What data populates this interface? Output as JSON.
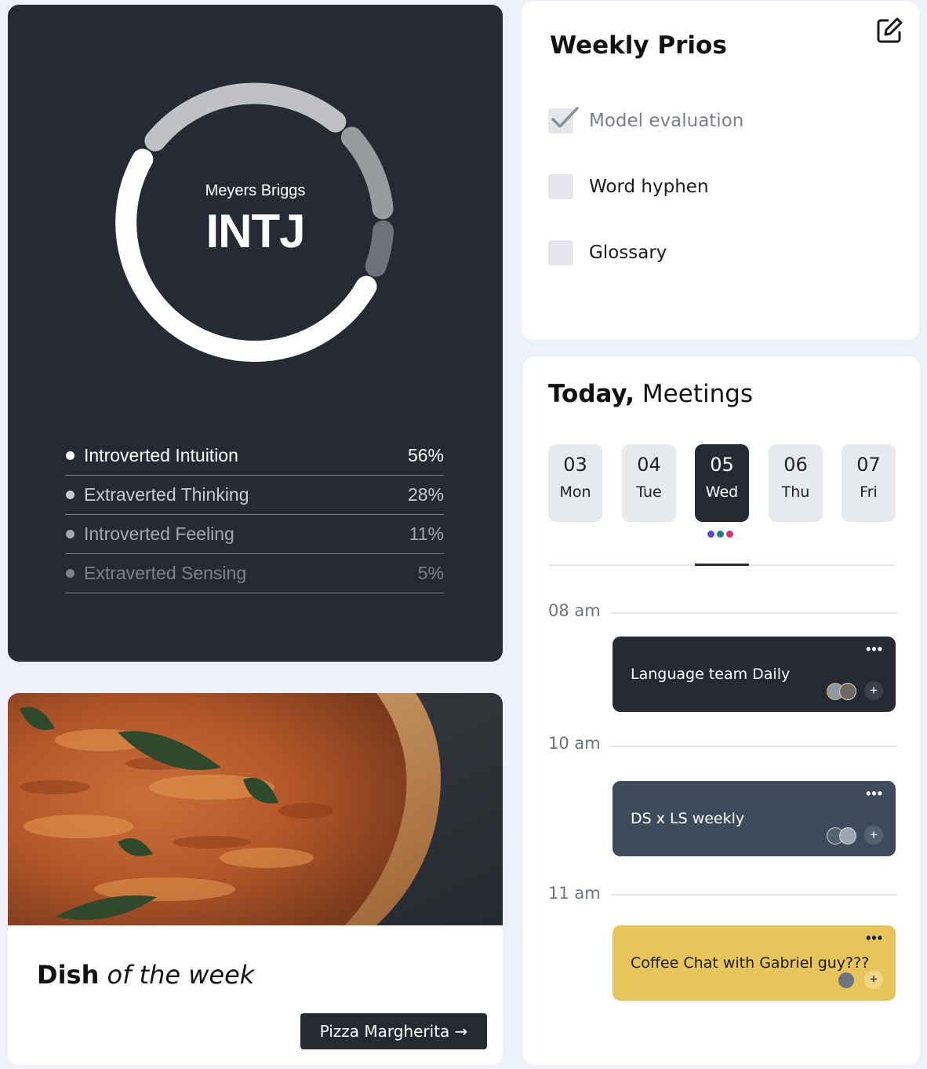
{
  "personality": {
    "subtitle": "Meyers Briggs",
    "type": "INTJ",
    "traits": [
      {
        "name": "Introverted Intuition",
        "percent": "56%",
        "color": "#ffffff"
      },
      {
        "name": "Extraverted Thinking",
        "percent": "28%",
        "color": "#c2c4c8"
      },
      {
        "name": "Introverted Feeling",
        "percent": "11%",
        "color": "#a2a5aa"
      },
      {
        "name": "Extraverted Sensing",
        "percent": "5%",
        "color": "#7b7f86"
      }
    ]
  },
  "dish": {
    "title_bold": "Dish",
    "title_rest": "of the week",
    "button_label": "Pizza Margherita →"
  },
  "prios": {
    "title": "Weekly Prios",
    "items": [
      {
        "label": "Model evaluation",
        "done": true
      },
      {
        "label": "Word hyphen",
        "done": false
      },
      {
        "label": "Glossary",
        "done": false
      }
    ]
  },
  "meetings": {
    "title_bold": "Today,",
    "title_rest": "Meetings",
    "days": [
      {
        "num": "03",
        "label": "Mon"
      },
      {
        "num": "04",
        "label": "Tue"
      },
      {
        "num": "05",
        "label": "Wed",
        "active": true
      },
      {
        "num": "06",
        "label": "Thu"
      },
      {
        "num": "07",
        "label": "Fri"
      }
    ],
    "event_dot_colors": [
      "#5a48d6",
      "#1f7a8c",
      "#d6336c"
    ],
    "slots": [
      {
        "time": "08 am",
        "meeting": "Language team Daily",
        "bg": "#252a35"
      },
      {
        "time": "10 am",
        "meeting": "DS x LS weekly",
        "bg": "#3d4b5c"
      },
      {
        "time": "11 am",
        "meeting": "Coffee Chat with Gabriel guy???",
        "bg": "#e8c55a"
      }
    ],
    "more_label": "•••",
    "add_label": "+"
  }
}
